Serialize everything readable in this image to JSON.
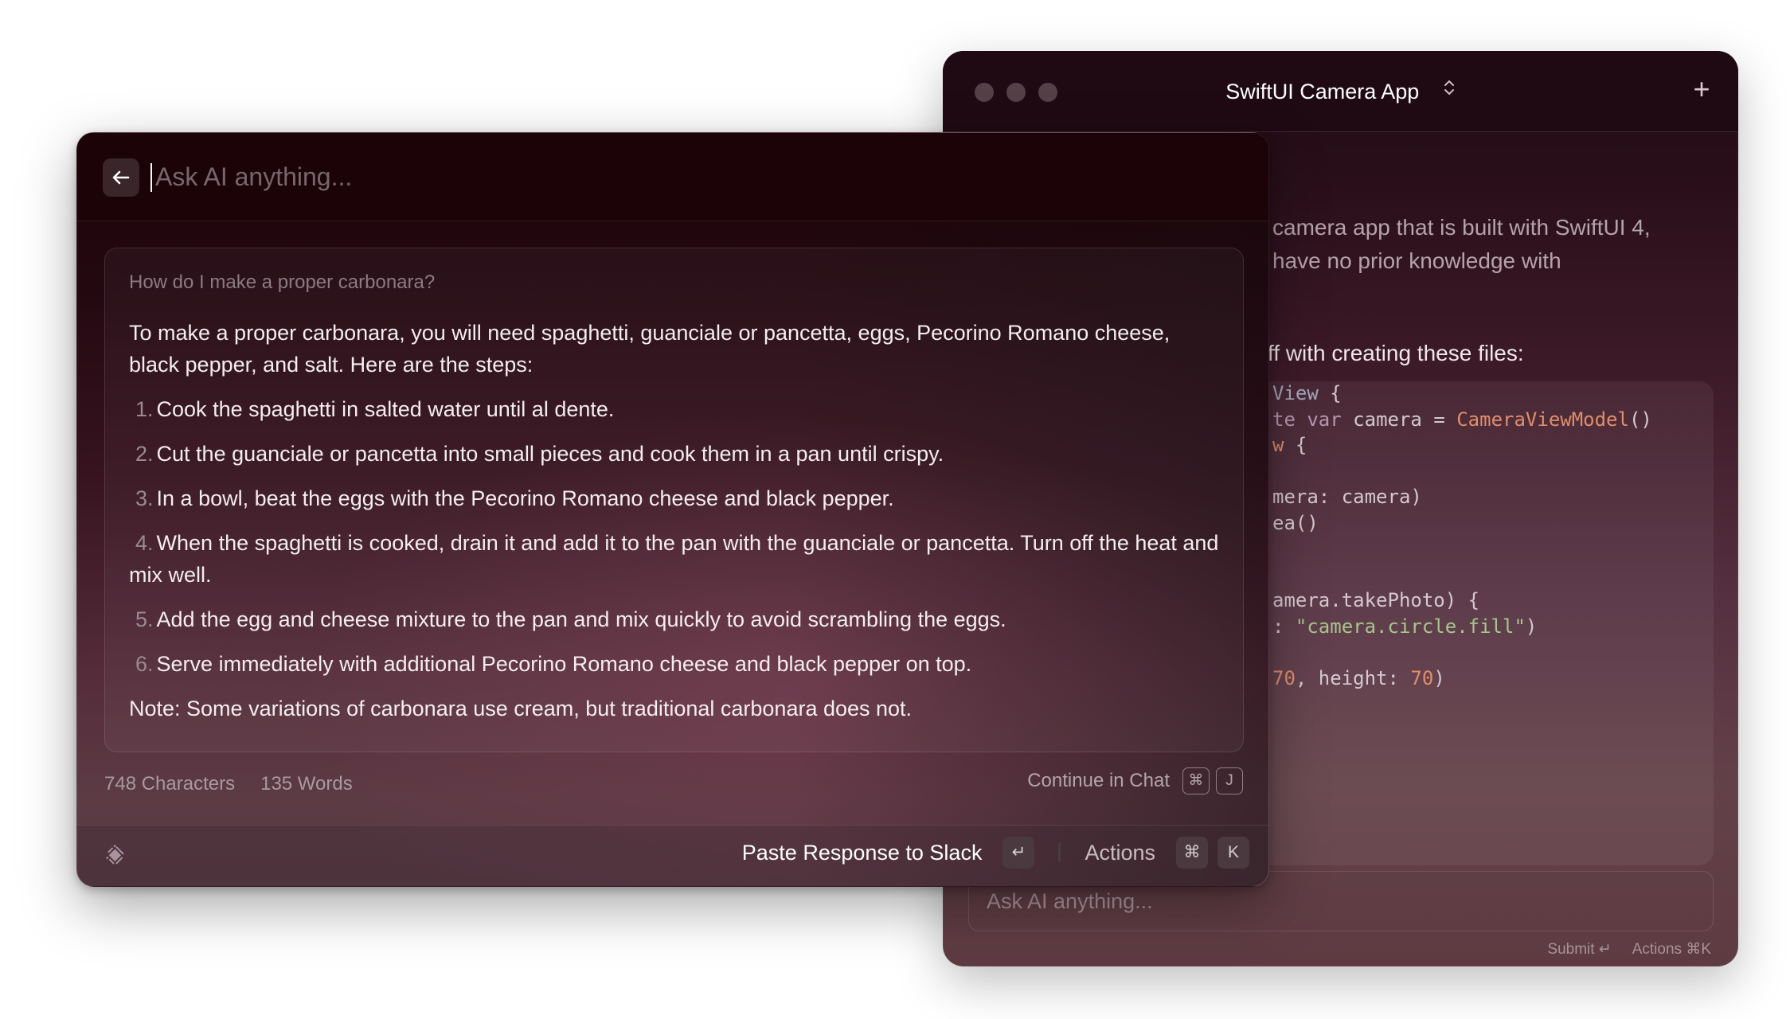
{
  "back_window": {
    "title": "SwiftUI Camera App",
    "title_switcher_icon": "chevron-up-down-icon",
    "new_chat_icon": "plus-icon",
    "intro_line1": "camera app that is built with SwiftUI 4,",
    "intro_line2": "have no prior knowledge with",
    "files_intro": "ff with creating these files:",
    "code_lines": [
      [
        {
          "t": "View",
          "c": "type"
        },
        {
          "t": " {",
          "c": "plain"
        }
      ],
      [
        {
          "t": "te ",
          "c": "kw"
        },
        {
          "t": "var",
          "c": "kw"
        },
        {
          "t": " camera = ",
          "c": "plain"
        },
        {
          "t": "CameraViewModel",
          "c": "fn"
        },
        {
          "t": "()",
          "c": "plain"
        }
      ],
      [
        {
          "t": "w",
          "c": "fn"
        },
        {
          "t": " {",
          "c": "plain"
        }
      ],
      [],
      [
        {
          "t": "mera: camera)",
          "c": "plain"
        }
      ],
      [
        {
          "t": "ea()",
          "c": "plain"
        }
      ],
      [],
      [],
      [
        {
          "t": "amera.takePhoto) {",
          "c": "plain"
        }
      ],
      [
        {
          "t": ": ",
          "c": "plain"
        },
        {
          "t": "\"camera.circle.fill\"",
          "c": "str"
        },
        {
          "t": ")",
          "c": "plain"
        }
      ],
      [],
      [
        {
          "t": "70",
          "c": "num"
        },
        {
          "t": ", height: ",
          "c": "plain"
        },
        {
          "t": "70",
          "c": "num"
        },
        {
          "t": ")",
          "c": "plain"
        }
      ]
    ],
    "input_placeholder": "Ask AI anything...",
    "footer": {
      "submit": "Submit ↵",
      "actions": "Actions ⌘K"
    }
  },
  "front_window": {
    "back_icon": "arrow-left-icon",
    "input_placeholder": "Ask AI anything...",
    "input_value": "",
    "question": "How do I make a proper carbonara?",
    "response_intro": "To make a proper carbonara, you will need spaghetti, guanciale or pancetta, eggs, Pecorino Romano cheese, black pepper, and salt. Here are the steps:",
    "steps": [
      {
        "num": "1.",
        "text": "Cook the spaghetti in salted water until al dente."
      },
      {
        "num": "2.",
        "text": "Cut the guanciale or pancetta into small pieces and cook them in a pan until crispy."
      },
      {
        "num": "3.",
        "text": "In a bowl, beat the eggs with the Pecorino Romano cheese and black pepper."
      },
      {
        "num": "4.",
        "text": "When the spaghetti is cooked, drain it and add it to the pan with the guanciale or pancetta. Turn off the heat and mix well."
      },
      {
        "num": "5.",
        "text": "Add the egg and cheese mixture to the pan and mix quickly to avoid scrambling the eggs."
      },
      {
        "num": "6.",
        "text": "Serve immediately with additional Pecorino Romano cheese and black pepper on top."
      }
    ],
    "note": "Note: Some variations of carbonara use cream, but traditional carbonara does not.",
    "stats": {
      "characters": "748 Characters",
      "words": "135 Words"
    },
    "continue_chat": {
      "label": "Continue in Chat",
      "keys": [
        "⌘",
        "J"
      ]
    },
    "footer": {
      "logo_icon": "raycast-logo-icon",
      "primary_action": "Paste Response to Slack",
      "primary_key": "↵",
      "actions_label": "Actions",
      "actions_keys": [
        "⌘",
        "K"
      ]
    }
  }
}
